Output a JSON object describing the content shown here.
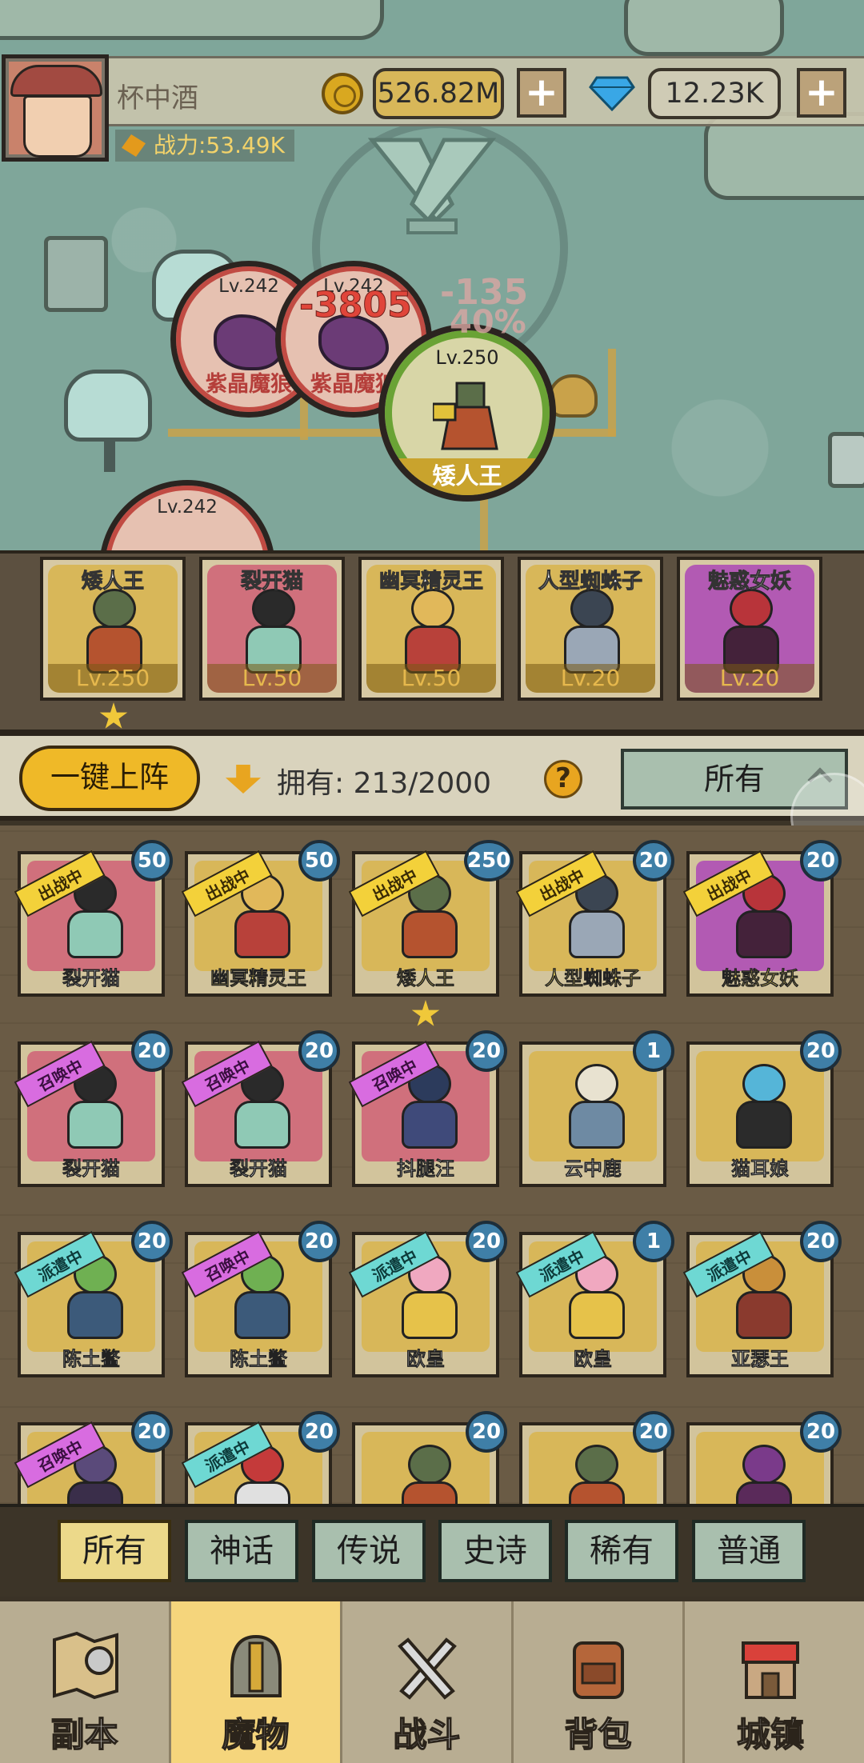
{
  "player": {
    "name": "杯中酒",
    "gold": "526.82M",
    "gems": "12.23K",
    "power": "战力:53.49K"
  },
  "battle": {
    "enemies": [
      {
        "level": "Lv.242",
        "name": "紫晶魔狼"
      },
      {
        "level": "Lv.242",
        "name": "紫晶魔狼"
      },
      {
        "level": "Lv.242",
        "name": ""
      }
    ],
    "boss": {
      "level": "Lv.250",
      "name": "矮人王"
    },
    "damage": [
      "-3805",
      "-135",
      "40%"
    ]
  },
  "team": [
    {
      "name": "矮人王",
      "level": "Lv.250"
    },
    {
      "name": "裂开猫",
      "level": "Lv.50"
    },
    {
      "name": "幽冥精灵王",
      "level": "Lv.50"
    },
    {
      "name": "人型蜘蛛子",
      "level": "Lv.20"
    },
    {
      "name": "魅惑女妖",
      "level": "Lv.20"
    }
  ],
  "controls": {
    "deploy_label": "一键上阵",
    "owned_label": "拥有: 213/2000",
    "help": "?",
    "filter": "所有"
  },
  "roster": [
    {
      "name": "裂开猫",
      "count": "50",
      "status": "出战中"
    },
    {
      "name": "幽冥精灵王",
      "count": "50",
      "status": "出战中"
    },
    {
      "name": "矮人王",
      "count": "250",
      "status": "出战中"
    },
    {
      "name": "人型蜘蛛子",
      "count": "20",
      "status": "出战中"
    },
    {
      "name": "魅惑女妖",
      "count": "20",
      "status": "出战中"
    },
    {
      "name": "裂开猫",
      "count": "20",
      "status": "召唤中"
    },
    {
      "name": "裂开猫",
      "count": "20",
      "status": "召唤中"
    },
    {
      "name": "抖腿汪",
      "count": "20",
      "status": "召唤中"
    },
    {
      "name": "云中鹿",
      "count": "1",
      "status": ""
    },
    {
      "name": "猫耳娘",
      "count": "20",
      "status": ""
    },
    {
      "name": "陈土鳖",
      "count": "20",
      "status": "派遣中"
    },
    {
      "name": "陈土鳖",
      "count": "20",
      "status": "召唤中"
    },
    {
      "name": "欧皇",
      "count": "20",
      "status": "派遣中"
    },
    {
      "name": "欧皇",
      "count": "1",
      "status": "派遣中"
    },
    {
      "name": "亚瑟王",
      "count": "20",
      "status": "派遣中"
    },
    {
      "name": "",
      "count": "20",
      "status": "召唤中"
    },
    {
      "name": "",
      "count": "20",
      "status": "派遣中"
    },
    {
      "name": "",
      "count": "20",
      "status": ""
    },
    {
      "name": "",
      "count": "20",
      "status": ""
    },
    {
      "name": "",
      "count": "20",
      "status": ""
    }
  ],
  "rarity_tabs": [
    "所有",
    "神话",
    "传说",
    "史诗",
    "稀有",
    "普通"
  ],
  "nav": [
    "副本",
    "魔物",
    "战斗",
    "背包",
    "城镇"
  ],
  "colors": {
    "accent": "#efb928",
    "tab_active": "#ecd98a",
    "panel": "#a9bfae"
  }
}
